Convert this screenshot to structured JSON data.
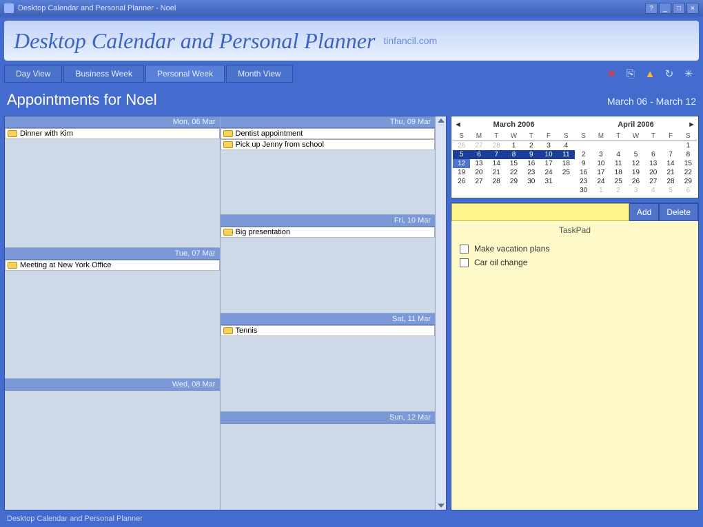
{
  "window": {
    "title": "Desktop Calendar and Personal Planner - Noel"
  },
  "banner": {
    "title": "Desktop Calendar and Personal Planner",
    "subtitle": "tinfancil.com"
  },
  "tabs": {
    "day": "Day View",
    "business": "Business Week",
    "personal": "Personal Week",
    "month": "Month View"
  },
  "subheader": {
    "title": "Appointments for Noel",
    "range": "March 06 - March 12"
  },
  "days": {
    "col1": [
      {
        "header": "Mon, 06 Mar",
        "appts": [
          "Dinner with Kim"
        ]
      },
      {
        "header": "Tue, 07 Mar",
        "appts": [
          "Meeting at New York Office"
        ]
      },
      {
        "header": "Wed, 08 Mar",
        "appts": []
      }
    ],
    "col2": [
      {
        "header": "Thu, 09 Mar",
        "appts": [
          "Dentist appointment",
          "Pick up Jenny from school"
        ]
      },
      {
        "header": "Fri, 10 Mar",
        "appts": [
          "Big presentation"
        ]
      },
      {
        "header": "Sat, 11 Mar",
        "appts": [
          "Tennis"
        ]
      },
      {
        "header": "Sun, 12 Mar",
        "appts": []
      }
    ]
  },
  "minical1": {
    "title": "March 2006",
    "dow": [
      "S",
      "M",
      "T",
      "W",
      "T",
      "F",
      "S"
    ],
    "grid": [
      {
        "d": 26,
        "dim": true
      },
      {
        "d": 27,
        "dim": true
      },
      {
        "d": 28,
        "dim": true
      },
      {
        "d": 1
      },
      {
        "d": 2
      },
      {
        "d": 3
      },
      {
        "d": 4
      },
      {
        "d": 5,
        "hl": true
      },
      {
        "d": 6,
        "hl": true
      },
      {
        "d": 7,
        "hl": true
      },
      {
        "d": 8,
        "hl": true
      },
      {
        "d": 9,
        "hl": true
      },
      {
        "d": 10,
        "hl": true
      },
      {
        "d": 11,
        "hl": true
      },
      {
        "d": 12,
        "today": true
      },
      {
        "d": 13
      },
      {
        "d": 14
      },
      {
        "d": 15
      },
      {
        "d": 16
      },
      {
        "d": 17
      },
      {
        "d": 18
      },
      {
        "d": 19
      },
      {
        "d": 20
      },
      {
        "d": 21
      },
      {
        "d": 22
      },
      {
        "d": 23
      },
      {
        "d": 24
      },
      {
        "d": 25
      },
      {
        "d": 26
      },
      {
        "d": 27
      },
      {
        "d": 28
      },
      {
        "d": 29
      },
      {
        "d": 30
      },
      {
        "d": 31
      },
      {
        "d": "",
        "dim": true
      }
    ]
  },
  "minical2": {
    "title": "April 2006",
    "dow": [
      "S",
      "M",
      "T",
      "W",
      "T",
      "F",
      "S"
    ],
    "grid": [
      {
        "d": "",
        "dim": true
      },
      {
        "d": "",
        "dim": true
      },
      {
        "d": "",
        "dim": true
      },
      {
        "d": "",
        "dim": true
      },
      {
        "d": "",
        "dim": true
      },
      {
        "d": "",
        "dim": true
      },
      {
        "d": 1
      },
      {
        "d": 2
      },
      {
        "d": 3
      },
      {
        "d": 4
      },
      {
        "d": 5
      },
      {
        "d": 6
      },
      {
        "d": 7
      },
      {
        "d": 8
      },
      {
        "d": 9
      },
      {
        "d": 10
      },
      {
        "d": 11
      },
      {
        "d": 12
      },
      {
        "d": 13
      },
      {
        "d": 14
      },
      {
        "d": 15
      },
      {
        "d": 16
      },
      {
        "d": 17
      },
      {
        "d": 18
      },
      {
        "d": 19
      },
      {
        "d": 20
      },
      {
        "d": 21
      },
      {
        "d": 22
      },
      {
        "d": 23
      },
      {
        "d": 24
      },
      {
        "d": 25
      },
      {
        "d": 26
      },
      {
        "d": 27
      },
      {
        "d": 28
      },
      {
        "d": 29
      },
      {
        "d": 30
      },
      {
        "d": 1,
        "dim": true
      },
      {
        "d": 2,
        "dim": true
      },
      {
        "d": 3,
        "dim": true
      },
      {
        "d": 4,
        "dim": true
      },
      {
        "d": 5,
        "dim": true
      },
      {
        "d": 6,
        "dim": true
      }
    ]
  },
  "taskpad": {
    "add": "Add",
    "delete": "Delete",
    "title": "TaskPad",
    "input_placeholder": "",
    "items": [
      "Make vacation plans",
      "Car oil change"
    ]
  },
  "statusbar": "Desktop Calendar and Personal Planner"
}
